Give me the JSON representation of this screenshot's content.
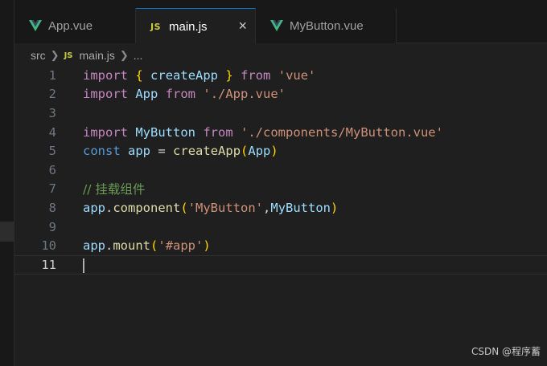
{
  "tabs": [
    {
      "label": "App.vue",
      "icon": "vue-icon",
      "active": false
    },
    {
      "label": "main.js",
      "icon": "js-icon",
      "active": true,
      "close": "×"
    },
    {
      "label": "MyButton.vue",
      "icon": "vue-icon",
      "active": false
    }
  ],
  "js_badge": "JS",
  "breadcrumb": {
    "folder": "src",
    "file": "main.js",
    "more": "..."
  },
  "code": {
    "line_numbers": [
      "1",
      "2",
      "3",
      "4",
      "5",
      "6",
      "7",
      "8",
      "9",
      "10",
      "11"
    ],
    "l1": {
      "import": "import",
      "open": "{",
      "createApp": "createApp",
      "close": "}",
      "from": "from",
      "src": "'vue'"
    },
    "l2": {
      "import": "import",
      "App": "App",
      "from": "from",
      "src": "'./App.vue'"
    },
    "l4": {
      "import": "import",
      "MyButton": "MyButton",
      "from": "from",
      "src": "'./components/MyButton.vue'"
    },
    "l5": {
      "const": "const",
      "app": "app",
      "eq": "=",
      "createApp": "createApp",
      "open": "(",
      "App": "App",
      "close": ")"
    },
    "l7": {
      "comment": "// 挂载组件"
    },
    "l8": {
      "app": "app",
      "dot": ".",
      "component": "component",
      "open": "(",
      "str": "'MyButton'",
      "comma": ",",
      "MyButton": "MyButton",
      "close": ")"
    },
    "l10": {
      "app": "app",
      "dot": ".",
      "mount": "mount",
      "open": "(",
      "str": "'#app'",
      "close": ")"
    }
  },
  "watermark": "CSDN @程序蓄",
  "colors": {
    "accent": "#0078d4",
    "vue": "#41b883",
    "js": "#cbcb41"
  }
}
